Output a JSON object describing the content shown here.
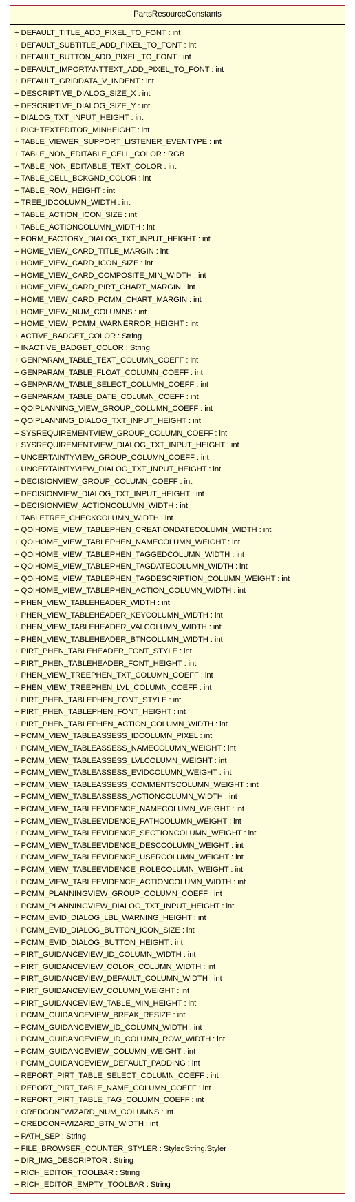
{
  "class": {
    "name": "PartsResourceConstants",
    "fill_color": "#fffedc",
    "border_color": "#a4243b",
    "attributes": [
      "+ DEFAULT_TITLE_ADD_PIXEL_TO_FONT : int",
      "+ DEFAULT_SUBTITLE_ADD_PIXEL_TO_FONT : int",
      "+ DEFAULT_BUTTON_ADD_PIXEL_TO_FONT : int",
      "+ DEFAULT_IMPORTANTTEXT_ADD_PIXEL_TO_FONT : int",
      "+ DEFAULT_GRIDDATA_V_INDENT : int",
      "+ DESCRIPTIVE_DIALOG_SIZE_X : int",
      "+ DESCRIPTIVE_DIALOG_SIZE_Y : int",
      "+ DIALOG_TXT_INPUT_HEIGHT : int",
      "+ RICHTEXTEDITOR_MINHEIGHT : int",
      "+ TABLE_VIEWER_SUPPORT_LISTENER_EVENTYPE : int",
      "+ TABLE_NON_EDITABLE_CELL_COLOR : RGB",
      "+ TABLE_NON_EDITABLE_TEXT_COLOR : int",
      "+ TABLE_CELL_BCKGND_COLOR : int",
      "+ TABLE_ROW_HEIGHT : int",
      "+ TREE_IDCOLUMN_WIDTH : int",
      "+ TABLE_ACTION_ICON_SIZE : int",
      "+ TABLE_ACTIONCOLUMN_WIDTH : int",
      "+ FORM_FACTORY_DIALOG_TXT_INPUT_HEIGHT : int",
      "+ HOME_VIEW_CARD_TITLE_MARGIN : int",
      "+ HOME_VIEW_CARD_ICON_SIZE : int",
      "+ HOME_VIEW_CARD_COMPOSITE_MIN_WIDTH : int",
      "+ HOME_VIEW_CARD_PIRT_CHART_MARGIN : int",
      "+ HOME_VIEW_CARD_PCMM_CHART_MARGIN : int",
      "+ HOME_VIEW_NUM_COLUMNS : int",
      "+ HOME_VIEW_PCMM_WARNERROR_HEIGHT : int",
      "+ ACTIVE_BADGET_COLOR : String",
      "+ INACTIVE_BADGET_COLOR : String",
      "+ GENPARAM_TABLE_TEXT_COLUMN_COEFF : int",
      "+ GENPARAM_TABLE_FLOAT_COLUMN_COEFF : int",
      "+ GENPARAM_TABLE_SELECT_COLUMN_COEFF : int",
      "+ GENPARAM_TABLE_DATE_COLUMN_COEFF : int",
      "+ QOIPLANNING_VIEW_GROUP_COLUMN_COEFF : int",
      "+ QOIPLANNING_DIALOG_TXT_INPUT_HEIGHT : int",
      "+ SYSREQUIREMENTVIEW_GROUP_COLUMN_COEFF : int",
      "+ SYSREQUIREMENTVIEW_DIALOG_TXT_INPUT_HEIGHT : int",
      "+ UNCERTAINTYVIEW_GROUP_COLUMN_COEFF : int",
      "+ UNCERTAINTYVIEW_DIALOG_TXT_INPUT_HEIGHT : int",
      "+ DECISIONVIEW_GROUP_COLUMN_COEFF : int",
      "+ DECISIONVIEW_DIALOG_TXT_INPUT_HEIGHT : int",
      "+ DECISIONVIEW_ACTIONCOLUMN_WIDTH : int",
      "+ TABLETREE_CHECKCOLUMN_WIDTH : int",
      "+ QOIHOME_VIEW_TABLEPHEN_CREATIONDATECOLUMN_WIDTH : int",
      "+ QOIHOME_VIEW_TABLEPHEN_NAMECOLUMN_WEIGHT : int",
      "+ QOIHOME_VIEW_TABLEPHEN_TAGGEDCOLUMN_WIDTH : int",
      "+ QOIHOME_VIEW_TABLEPHEN_TAGDATECOLUMN_WIDTH : int",
      "+ QOIHOME_VIEW_TABLEPHEN_TAGDESCRIPTION_COLUMN_WEIGHT : int",
      "+ QOIHOME_VIEW_TABLEPHEN_ACTION_COLUMN_WIDTH : int",
      "+ PHEN_VIEW_TABLEHEADER_WIDTH : int",
      "+ PHEN_VIEW_TABLEHEADER_KEYCOLUMN_WIDTH : int",
      "+ PHEN_VIEW_TABLEHEADER_VALCOLUMN_WIDTH : int",
      "+ PHEN_VIEW_TABLEHEADER_BTNCOLUMN_WIDTH : int",
      "+ PIRT_PHEN_TABLEHEADER_FONT_STYLE : int",
      "+ PIRT_PHEN_TABLEHEADER_FONT_HEIGHT : int",
      "+ PHEN_VIEW_TREEPHEN_TXT_COLUMN_COEFF : int",
      "+ PHEN_VIEW_TREEPHEN_LVL_COLUMN_COEFF : int",
      "+ PIRT_PHEN_TABLEPHEN_FONT_STYLE : int",
      "+ PIRT_PHEN_TABLEPHEN_FONT_HEIGHT : int",
      "+ PIRT_PHEN_TABLEPHEN_ACTION_COLUMN_WIDTH : int",
      "+ PCMM_VIEW_TABLEASSESS_IDCOLUMN_PIXEL : int",
      "+ PCMM_VIEW_TABLEASSESS_NAMECOLUMN_WEIGHT : int",
      "+ PCMM_VIEW_TABLEASSESS_LVLCOLUMN_WEIGHT : int",
      "+ PCMM_VIEW_TABLEASSESS_EVIDCOLUMN_WEIGHT : int",
      "+ PCMM_VIEW_TABLEASSESS_COMMENTSCOLUMN_WEIGHT : int",
      "+ PCMM_VIEW_TABLEASSESS_ACTIONCOLUMN_WIDTH : int",
      "+ PCMM_VIEW_TABLEEVIDENCE_NAMECOLUMN_WEIGHT : int",
      "+ PCMM_VIEW_TABLEEVIDENCE_PATHCOLUMN_WEIGHT : int",
      "+ PCMM_VIEW_TABLEEVIDENCE_SECTIONCOLUMN_WEIGHT : int",
      "+ PCMM_VIEW_TABLEEVIDENCE_DESCCOLUMN_WEIGHT : int",
      "+ PCMM_VIEW_TABLEEVIDENCE_USERCOLUMN_WEIGHT : int",
      "+ PCMM_VIEW_TABLEEVIDENCE_ROLECOLUMN_WEIGHT : int",
      "+ PCMM_VIEW_TABLEEVIDENCE_ACTIONCOLUMN_WIDTH : int",
      "+ PCMM_PLANNINGVIEW_GROUP_COLUMN_COEFF : int",
      "+ PCMM_PLANNINGVIEW_DIALOG_TXT_INPUT_HEIGHT : int",
      "+ PCMM_EVID_DIALOG_LBL_WARNING_HEIGHT : int",
      "+ PCMM_EVID_DIALOG_BUTTON_ICON_SIZE : int",
      "+ PCMM_EVID_DIALOG_BUTTON_HEIGHT : int",
      "+ PIRT_GUIDANCEVIEW_ID_COLUMN_WIDTH : int",
      "+ PIRT_GUIDANCEVIEW_COLOR_COLUMN_WIDTH : int",
      "+ PIRT_GUIDANCEVIEW_DEFAULT_COLUMN_WIDTH : int",
      "+ PIRT_GUIDANCEVIEW_COLUMN_WEIGHT : int",
      "+ PIRT_GUIDANCEVIEW_TABLE_MIN_HEIGHT : int",
      "+ PCMM_GUIDANCEVIEW_BREAK_RESIZE : int",
      "+ PCMM_GUIDANCEVIEW_ID_COLUMN_WIDTH : int",
      "+ PCMM_GUIDANCEVIEW_ID_COLUMN_ROW_WIDTH : int",
      "+ PCMM_GUIDANCEVIEW_COLUMN_WEIGHT : int",
      "+ PCMM_GUIDANCEVIEW_DEFAULT_PADDING : int",
      "+ REPORT_PIRT_TABLE_SELECT_COLUMN_COEFF : int",
      "+ REPORT_PIRT_TABLE_NAME_COLUMN_COEFF : int",
      "+ REPORT_PIRT_TABLE_TAG_COLUMN_COEFF : int",
      "+ CREDCONFWIZARD_NUM_COLUMNS : int",
      "+ CREDCONFWIZARD_BTN_WIDTH : int",
      "+ PATH_SEP : String",
      "+ FILE_BROWSER_COUNTER_STYLER : StyledString.Styler",
      "+ DIR_IMG_DESCRIPTOR : String",
      "+ RICH_EDITOR_TOOLBAR : String",
      "+ RICH_EDITOR_EMPTY_TOOLBAR : String"
    ],
    "operations": []
  }
}
